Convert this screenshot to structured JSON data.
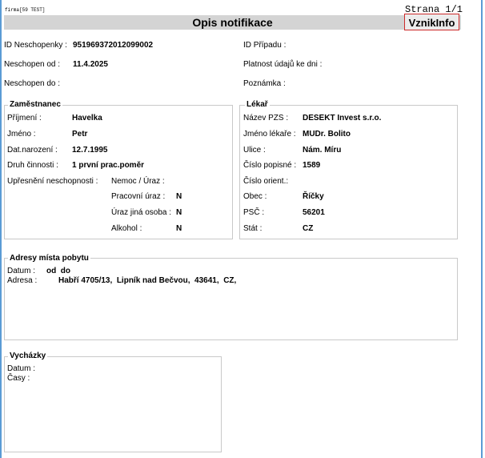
{
  "header": {
    "firma": "firma[59 TEST]",
    "strana": "Strana 1/1",
    "title": "Opis notifikace",
    "badge": "VznikInfo"
  },
  "top": {
    "id_neschopenky_label": "ID Neschopenky :",
    "id_neschopenky_value": "951969372012099002",
    "neschopen_od_label": "Neschopen od :",
    "neschopen_od_value": "11.4.2025",
    "neschopen_do_label": "Neschopen do :",
    "id_pripadu_label": "ID Případu :",
    "platnost_label": "Platnost údajů ke dni :",
    "poznamka_label": "Poznámka :"
  },
  "zamestnanec": {
    "title": "Zaměstnanec",
    "prijmeni_label": "Příjmení :",
    "prijmeni_value": "Havelka",
    "jmeno_label": "Jméno :",
    "jmeno_value": "Petr",
    "datnar_label": "Dat.narození :",
    "datnar_value": "12.7.1995",
    "druh_label": "Druh činnosti :",
    "druh_value": "1 první prac.poměr",
    "upresneni_label": "Upřesnění neschopnosti :",
    "nemoc_label": "Nemoc / Úraz :",
    "pracovni_label": "Pracovní úraz :",
    "pracovni_value": "N",
    "jina_label": "Úraz jiná osoba :",
    "jina_value": "N",
    "alkohol_label": "Alkohol :",
    "alkohol_value": "N"
  },
  "lekar": {
    "title": "Lékař",
    "pzs_label": "Název PZS :",
    "pzs_value": "DESEKT Invest s.r.o.",
    "jmeno_label": "Jméno lékaře :",
    "jmeno_value": "MUDr. Bolito",
    "ulice_label": "Ulice :",
    "ulice_value": "Nám. Míru",
    "popisne_label": "Číslo popisné :",
    "popisne_value": "1589",
    "orient_label": "Číslo orient.:",
    "obec_label": "Obec :",
    "obec_value": "Říčky",
    "psc_label": "PSČ :",
    "psc_value": "56201",
    "stat_label": "Stát :",
    "stat_value": "CZ"
  },
  "adresy": {
    "title": "Adresy místa pobytu",
    "datum_label": "Datum :",
    "datum_value": "od  do",
    "adresa_label": "Adresa :",
    "adresa_value": "Habří 4705/13,  Lipník nad Bečvou,  43641,  CZ,"
  },
  "vychazky": {
    "title": "Vycházky",
    "datum_label": "Datum :",
    "casy_label": "Časy :"
  }
}
